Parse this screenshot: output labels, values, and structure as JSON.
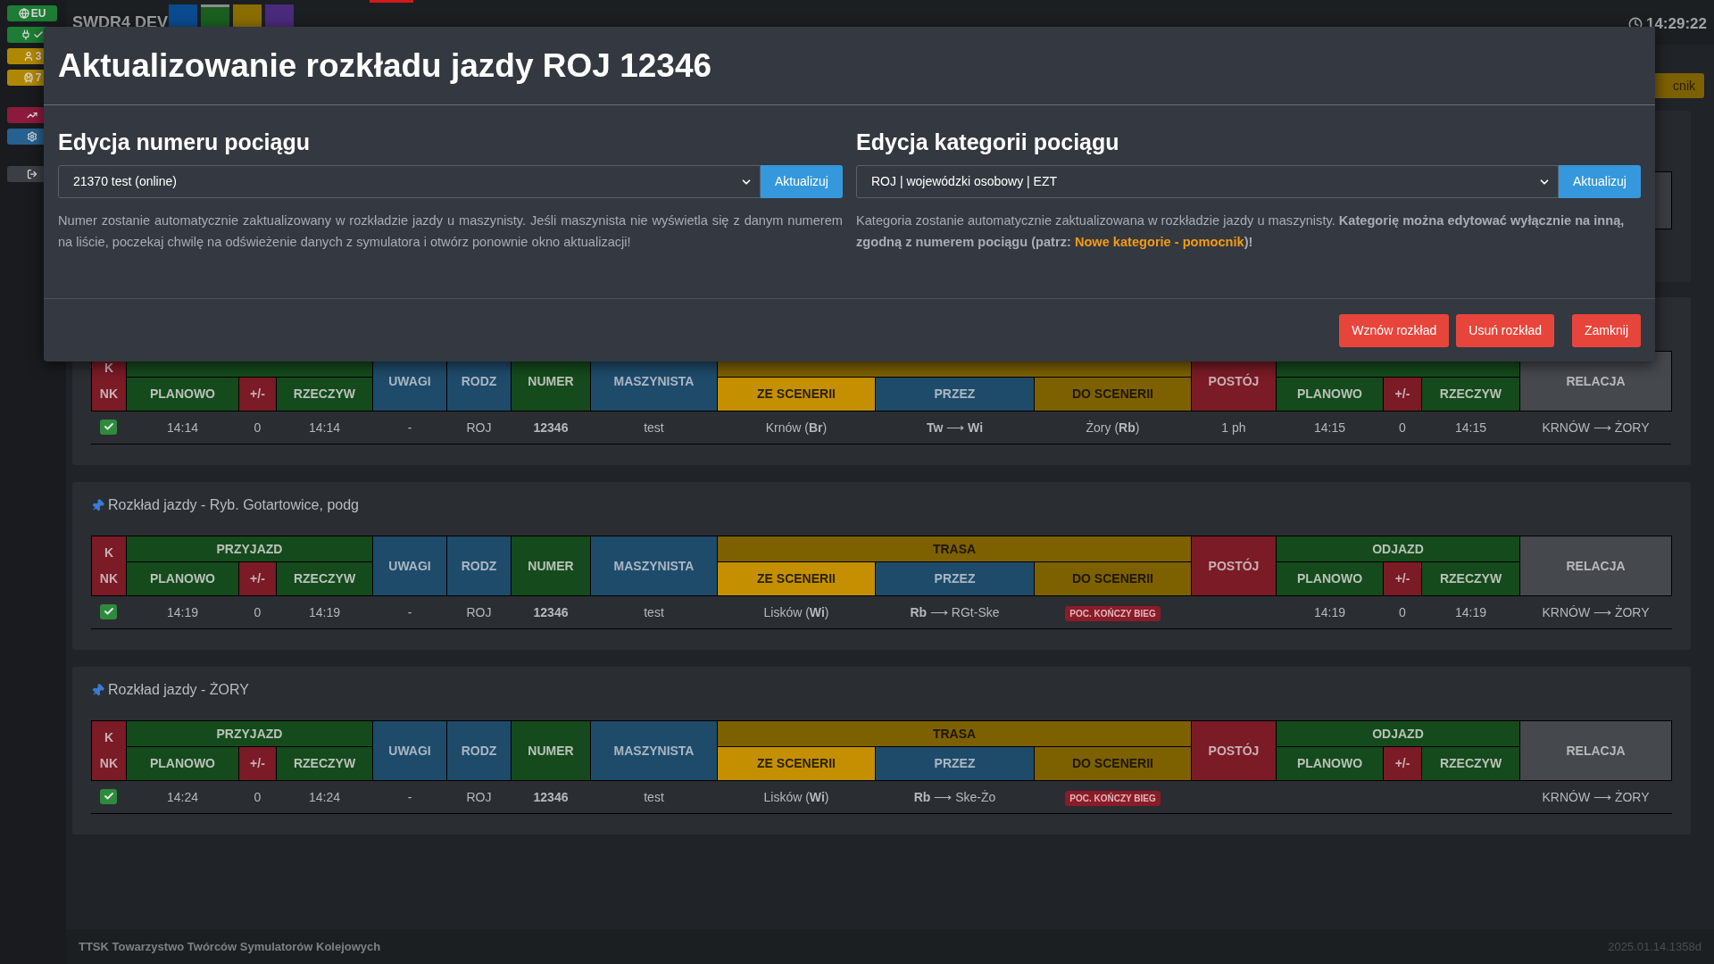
{
  "sidebar": {
    "badges": [
      {
        "kind": "globe",
        "label": "EU",
        "color": "#1e7d34"
      },
      {
        "kind": "plug",
        "color": "#1e7d34"
      },
      {
        "kind": "user",
        "label": "3",
        "color": "#b08800"
      },
      {
        "kind": "train",
        "label": "7",
        "color": "#b08800"
      },
      {
        "kind": "chart",
        "color": "#8c1a3c"
      },
      {
        "kind": "gear",
        "color": "#27618f"
      },
      {
        "kind": "logout",
        "color": "#3b3f45"
      }
    ]
  },
  "header": {
    "brand": "SWDR4 DEV",
    "tabs": [
      {
        "color": "#0a4a8f",
        "selected": false
      },
      {
        "color": "#1b5e20",
        "selected": true
      },
      {
        "color": "#8a6d00",
        "selected": false
      },
      {
        "color": "#4a2a7a",
        "selected": false
      }
    ],
    "clock": "14:29:22"
  },
  "toolbar": {
    "button": "cnik"
  },
  "sections": [
    {
      "header": {
        "kn": [
          "K",
          "NK"
        ],
        "arrival_cols": [
          "PLANOWO",
          "+/-",
          "RZECZYW"
        ],
        "remarks": "UWAGI",
        "type_col": "RODZ",
        "number": "NUMER",
        "driver": "MASZYNISTA",
        "route_cols": [
          "ZE SCENERII",
          "PRZEZ",
          "DO SCENERII"
        ],
        "stop": "POSTÓJ",
        "departure_cols": [
          "PLANOWO",
          "+/-",
          "RZECZYW"
        ],
        "relation": "RELACJA"
      },
      "row": {
        "checked": true,
        "arr_plan": "14:14",
        "arr_delay": "0",
        "arr_real": "14:14",
        "remarks": "-",
        "category": "ROJ",
        "number": "12346",
        "driver": "test",
        "from": "Krnów (**Br**)",
        "via": "**Tw** ⟶ **Wi**",
        "to": "Żory (**Rb**)",
        "stop": "1 ph",
        "dep_plan": "14:15",
        "dep_delay": "0",
        "dep_real": "14:15",
        "relation": "KRNÓW ⟶ ŻORY"
      }
    },
    {
      "title": "Rozkład jazdy - Ryb. Gotartowice, podg",
      "header": {
        "kn": [
          "K",
          "NK"
        ],
        "arrival": "PRZYJAZD",
        "arrival_cols": [
          "PLANOWO",
          "+/-",
          "RZECZYW"
        ],
        "remarks": "UWAGI",
        "type_col": "RODZ",
        "number": "NUMER",
        "driver": "MASZYNISTA",
        "route": "TRASA",
        "route_cols": [
          "ZE SCENERII",
          "PRZEZ",
          "DO SCENERII"
        ],
        "stop": "POSTÓJ",
        "departure": "ODJAZD",
        "departure_cols": [
          "PLANOWO",
          "+/-",
          "RZECZYW"
        ],
        "relation": "RELACJA"
      },
      "row": {
        "checked": true,
        "arr_plan": "14:19",
        "arr_delay": "0",
        "arr_real": "14:19",
        "remarks": "-",
        "category": "ROJ",
        "number": "12346",
        "driver": "test",
        "from": "Lisków (**Wi**)",
        "via": "**Rb** ⟶ RGt-Ske",
        "to_badge": "POC. KOŃCZY BIEG",
        "dep_plan": "14:19",
        "dep_delay": "0",
        "dep_real": "14:19",
        "relation": "KRNÓW ⟶ ŻORY"
      }
    },
    {
      "title": "Rozkład jazdy - ŻORY",
      "header": {
        "kn": [
          "K",
          "NK"
        ],
        "arrival": "PRZYJAZD",
        "arrival_cols": [
          "PLANOWO",
          "+/-",
          "RZECZYW"
        ],
        "remarks": "UWAGI",
        "type_col": "RODZ",
        "number": "NUMER",
        "driver": "MASZYNISTA",
        "route": "TRASA",
        "route_cols": [
          "ZE SCENERII",
          "PRZEZ",
          "DO SCENERII"
        ],
        "stop": "POSTÓJ",
        "departure": "ODJAZD",
        "departure_cols": [
          "PLANOWO",
          "+/-",
          "RZECZYW"
        ],
        "relation": "RELACJA"
      },
      "row": {
        "checked": true,
        "arr_plan": "14:24",
        "arr_delay": "0",
        "arr_real": "14:24",
        "remarks": "-",
        "category": "ROJ",
        "number": "12346",
        "driver": "test",
        "from": "Lisków (**Wi**)",
        "via": "**Rb** ⟶ Ske-Żo",
        "to_badge": "POC. KOŃCZY BIEG",
        "relation": "KRNÓW ⟶ ŻORY"
      }
    }
  ],
  "modal": {
    "title": "Aktualizowanie rozkładu jazdy ROJ 12346",
    "number_panel": {
      "heading": "Edycja numeru pociągu",
      "select_value": "21370 test (online)",
      "button": "Aktualizuj",
      "help": "Numer zostanie automatycznie zaktualizowany w rozkładzie jazdy u maszynisty. Jeśli maszynista nie wyświetla się z danym numerem na liście, poczekaj chwilę na odświeżenie danych z symulatora i otwórz ponownie okno aktualizacji!"
    },
    "category_panel": {
      "heading": "Edycja kategorii pociągu",
      "select_value": "ROJ | wojewódzki osobowy | EZT",
      "button": "Aktualizuj",
      "help_before": "Kategoria zostanie automatycznie zaktualizowana w rozkładzie jazdy u maszynisty. **Kategorię można edytować wyłącznie na inną, zgodną z numerem pociągu (patrz:**",
      "help_link": "Nowe kategorie - pomocnik",
      "help_after": "**)!**"
    },
    "buttons": [
      "Wznów rozkład",
      "Usuń rozkład",
      "Zamknij"
    ]
  },
  "footer": {
    "left": "TTSK Towarzystwo Twórców Symulatorów Kolejowych",
    "right": "2025.01.14.1358d"
  }
}
